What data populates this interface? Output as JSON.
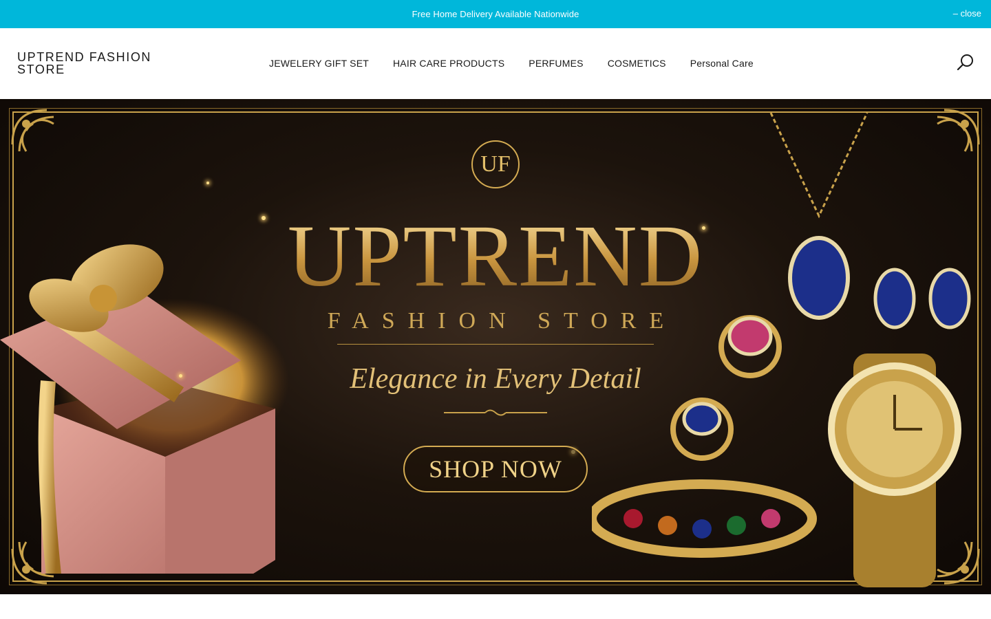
{
  "announcement": {
    "text": "Free Home Delivery Available Nationwide",
    "close_label": "– close",
    "background": "#00b7da"
  },
  "header": {
    "logo": "UPTREND FASHION STORE",
    "nav": [
      "JEWELERY GIFT SET",
      "HAIR CARE PRODUCTS",
      "PERFUMES",
      "COSMETICS",
      "Personal Care"
    ],
    "search_icon": "search-icon"
  },
  "hero": {
    "monogram": "UF",
    "title": "UPTREND",
    "subtitle": "FASHION STORE",
    "tagline": "Elegance in Every Detail",
    "cta_label": "SHOP NOW",
    "accent": "#d4ab52"
  }
}
